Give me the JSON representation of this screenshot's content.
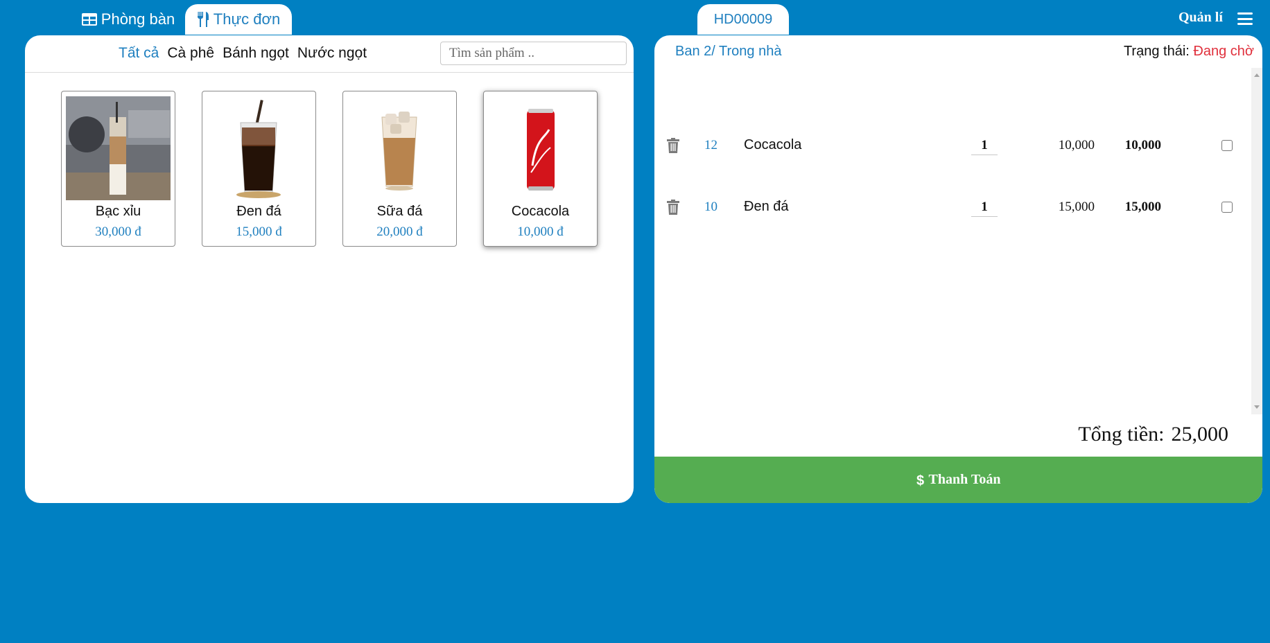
{
  "nav": {
    "rooms_tab": "Phòng bàn",
    "menu_tab": "Thực đơn",
    "invoice_tab": "HD00009",
    "manage": "Quản lí"
  },
  "categories": [
    "Tất cả",
    "Cà phê",
    "Bánh ngọt",
    "Nước ngọt"
  ],
  "active_category": "Tất cả",
  "search": {
    "placeholder": "Tìm sản phẩm .."
  },
  "products": [
    {
      "name": "Bạc xỉu",
      "price": "30,000 đ"
    },
    {
      "name": "Đen đá",
      "price": "15,000 đ"
    },
    {
      "name": "Sữa đá",
      "price": "20,000 đ"
    },
    {
      "name": "Cocacola",
      "price": "10,000 đ"
    }
  ],
  "order": {
    "table": "Ban 2/ Trong nhà",
    "status_label": "Trạng thái:",
    "status_value": "Đang chờ",
    "items": [
      {
        "code": "12",
        "name": "Cocacola",
        "qty": "1",
        "unit_price": "10,000",
        "total": "10,000"
      },
      {
        "code": "10",
        "name": "Đen đá",
        "qty": "1",
        "unit_price": "15,000",
        "total": "15,000"
      }
    ],
    "total_label": "Tổng tiền:",
    "total_value": "25,000",
    "pay_label": "Thanh Toán"
  },
  "colors": {
    "background": "#0080c2",
    "accent": "#1e7fbf",
    "pay": "#55ad51",
    "status": "#e0303c"
  }
}
